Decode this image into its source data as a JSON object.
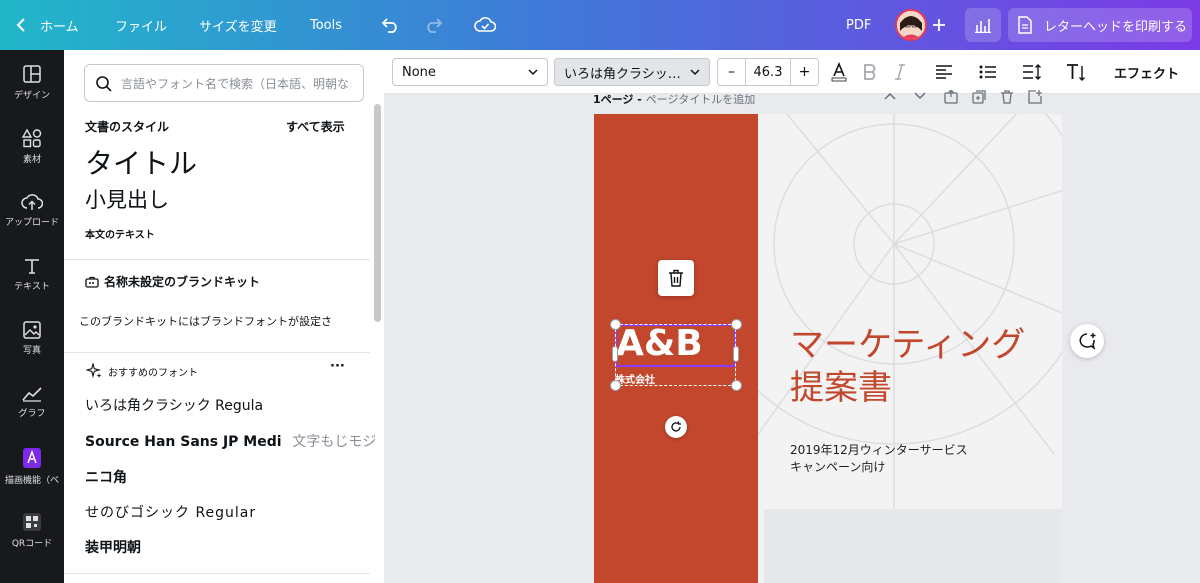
{
  "topbar": {
    "home_label": "ホーム",
    "file_label": "ファイル",
    "resize_label": "サイズを変更",
    "tools_label": "Tools",
    "pdf_label": "PDF",
    "print_label": "レターヘッドを印刷する"
  },
  "rail": {
    "items": [
      {
        "label": "デザイン",
        "icon": "layout-icon"
      },
      {
        "label": "素材",
        "icon": "elements-icon"
      },
      {
        "label": "アップロード",
        "icon": "upload-cloud-icon"
      },
      {
        "label": "テキスト",
        "icon": "text-icon"
      },
      {
        "label": "写真",
        "icon": "photo-icon"
      },
      {
        "label": "グラフ",
        "icon": "chart-icon"
      },
      {
        "label": "描画機能（ベ",
        "icon": "draw-icon"
      },
      {
        "label": "QRコード",
        "icon": "qr-icon"
      }
    ]
  },
  "panel": {
    "search_placeholder": "言語やフォント名で検索（日本語、明朝な",
    "doc_styles_heading": "文書のスタイル",
    "show_all": "すべて表示",
    "style_title": "タイトル",
    "style_subheading": "小見出し",
    "style_body": "本文のテキスト",
    "brandkit_heading": "名称未設定のブランドキット",
    "brandkit_note": "このブランドキットにはブランドフォントが設定さ",
    "recommended_heading": "おすすめのフォント",
    "more_label": "···",
    "fonts": [
      {
        "name": "いろは角クラシック Regula",
        "sample": ""
      },
      {
        "name": "Source Han Sans JP Medi",
        "sample": "文字もじモジ"
      },
      {
        "name": "ニコ角",
        "sample": ""
      },
      {
        "name": "せのびゴシック Regular",
        "sample": ""
      },
      {
        "name": "装甲明朝",
        "sample": ""
      }
    ]
  },
  "toolbar": {
    "style_select": "None",
    "font_select": "いろは角クラシッ…",
    "font_size": "46.3",
    "minus_label": "–",
    "plus_label": "+",
    "effects_label": "エフェクト"
  },
  "canvas": {
    "page_label": "1ページ - ",
    "page_title_placeholder": "ページタイトルを追加",
    "logo_text": "A&B",
    "logo_sub": "株式会社",
    "headline_line1": "マーケティング",
    "headline_line2": "提案書",
    "sub_line1": "2019年12月ウィンターサービス",
    "sub_line2": "キャンペーン向け"
  },
  "colors": {
    "accent_red": "#c2472c",
    "selection": "#8b3dff"
  }
}
